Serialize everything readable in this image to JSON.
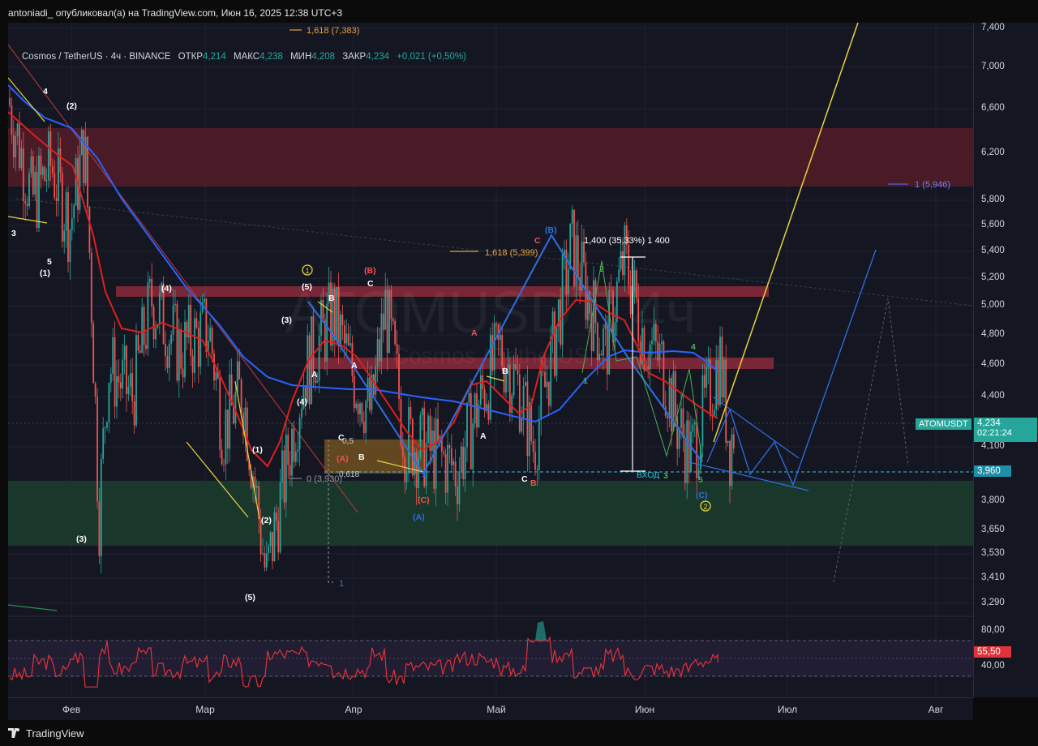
{
  "header": {
    "published_by": "antoniadi_ опубликовал(а) на TradingView.com, Июн 16, 2025 12:38 UTC+3"
  },
  "legend": {
    "symbol": "Cosmos / TetherUS · 4ч · BINANCE",
    "open_label": "ОТКР",
    "open": "4,214",
    "high_label": "МАКС",
    "high": "4,238",
    "low_label": "МИН",
    "low": "4,208",
    "close_label": "ЗАКР",
    "close": "4,234",
    "change": "+0,021 (+0,50%)"
  },
  "watermark": {
    "symbol": "ATOMUSDT, 4ч",
    "name": "Cosmos / TetherUS"
  },
  "price_scale": {
    "ticks": [
      "7,400",
      "7,000",
      "6,600",
      "6,200",
      "5,800",
      "5,600",
      "5,400",
      "5,200",
      "5,000",
      "4,800",
      "4,600",
      "4,400",
      "4,100",
      "3,800",
      "3,650",
      "3,530",
      "3,410",
      "3,290"
    ],
    "symbol_tag": "ATOMUSDT",
    "last_price": "4,234",
    "countdown": "02:21:24",
    "entry_price": "3,960",
    "rsi_ticks": [
      "80,00",
      "40,00"
    ],
    "rsi_value": "55,50"
  },
  "time_axis": {
    "labels": [
      "Фев",
      "Мар",
      "Апр",
      "Май",
      "Июн",
      "Июл",
      "Авг"
    ]
  },
  "colors": {
    "up": "#26a69a",
    "down": "#ef5350",
    "ma_fast": "#e01e1e",
    "ma_slow": "#2962ff",
    "projection": "#e8d33f",
    "wave_blue": "#2f6fe0",
    "zone_red": "#8b2a3a",
    "zone_green": "#1f4a35",
    "rsi": "#e0323a"
  },
  "annotations": {
    "fib_top": "1,618 (7,383)",
    "fib_mid": "1,618 (5,399)",
    "fib_right": "1 (5,946)",
    "fib_zero": "0 (3,930)",
    "fib_05": "0,5",
    "fib_0618": "0,618",
    "fib_one": "1",
    "measure": "1,400 (35,33%) 1 400",
    "entry": "ВХОД",
    "waves": [
      "4",
      "3",
      "5",
      "(1)",
      "(2)",
      "(3)",
      "(4)",
      "(5)",
      "(1)",
      "(2)",
      "(3)",
      "(4)",
      "(5)",
      "(A)",
      "(B)",
      "(C)",
      "A",
      "B",
      "C",
      "A",
      "B",
      "C",
      "1",
      "2",
      "3",
      "4",
      "5",
      "1",
      "2",
      "(A)",
      "(B)",
      "(C)",
      "A",
      "B",
      "C"
    ]
  },
  "footer": {
    "brand": "TradingView"
  },
  "chart_data": {
    "type": "candlestick",
    "title": "Cosmos / TetherUS · 4ч · BINANCE",
    "x_range": [
      "2025-01-15",
      "2025-08-05"
    ],
    "ylim": [
      3.2,
      7.5
    ],
    "y_scale": "log",
    "ohlc_last": {
      "open": 4.214,
      "high": 4.238,
      "low": 4.208,
      "close": 4.234
    },
    "price_path": [
      [
        "2025-01-15",
        6.7
      ],
      [
        "2025-01-20",
        5.8
      ],
      [
        "2025-01-24",
        6.1
      ],
      [
        "2025-01-28",
        5.6
      ],
      [
        "2025-01-31",
        6.3
      ],
      [
        "2025-02-03",
        3.7
      ],
      [
        "2025-02-05",
        4.6
      ],
      [
        "2025-02-10",
        4.4
      ],
      [
        "2025-02-14",
        5.05
      ],
      [
        "2025-02-20",
        4.7
      ],
      [
        "2025-02-26",
        4.85
      ],
      [
        "2025-03-01",
        4.2
      ],
      [
        "2025-03-05",
        4.45
      ],
      [
        "2025-03-10",
        3.4
      ],
      [
        "2025-03-14",
        3.95
      ],
      [
        "2025-03-18",
        4.55
      ],
      [
        "2025-03-24",
        4.95
      ],
      [
        "2025-03-28",
        4.55
      ],
      [
        "2025-04-01",
        4.3
      ],
      [
        "2025-04-04",
        5.0
      ],
      [
        "2025-04-08",
        4.15
      ],
      [
        "2025-04-15",
        4.05
      ],
      [
        "2025-04-19",
        3.97
      ],
      [
        "2025-04-24",
        4.4
      ],
      [
        "2025-04-28",
        4.7
      ],
      [
        "2025-05-02",
        4.45
      ],
      [
        "2025-05-05",
        4.1
      ],
      [
        "2025-05-09",
        4.7
      ],
      [
        "2025-05-13",
        5.45
      ],
      [
        "2025-05-17",
        5.0
      ],
      [
        "2025-05-20",
        4.7
      ],
      [
        "2025-05-24",
        5.35
      ],
      [
        "2025-05-28",
        4.8
      ],
      [
        "2025-06-01",
        4.6
      ],
      [
        "2025-06-04",
        4.25
      ],
      [
        "2025-06-07",
        4.05
      ],
      [
        "2025-06-10",
        4.35
      ],
      [
        "2025-06-13",
        4.65
      ],
      [
        "2025-06-15",
        4.1
      ],
      [
        "2025-06-16",
        4.234
      ]
    ],
    "indicators": [
      {
        "name": "MA fast",
        "color": "#e01e1e"
      },
      {
        "name": "MA slow",
        "color": "#2962ff"
      }
    ],
    "levels": {
      "last_price": 4.234,
      "entry": 3.96,
      "fib_1618_upper": 7.383,
      "fib_1618_mid": 5.399,
      "fib_1_right": 5.946,
      "fib_0": 3.93
    },
    "zones": [
      {
        "type": "resistance",
        "from": 5.95,
        "to": 6.42
      },
      {
        "type": "resistance",
        "from": 5.1,
        "to": 5.2
      },
      {
        "type": "resistance",
        "from": 4.58,
        "to": 4.66
      },
      {
        "type": "support",
        "from": 3.58,
        "to": 3.95
      }
    ],
    "rsi": {
      "value": 55.5,
      "ticks": [
        80,
        40
      ]
    }
  }
}
